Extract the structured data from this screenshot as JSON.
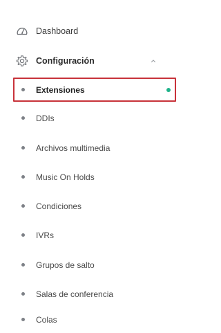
{
  "sidebar": {
    "dashboard": {
      "label": "Dashboard",
      "icon": "dashboard-gauge-icon"
    },
    "configuracion": {
      "label": "Configuración",
      "icon": "gear-icon",
      "expanded": true
    },
    "sub_items": [
      {
        "label": "Extensiones",
        "active": true
      },
      {
        "label": "DDIs"
      },
      {
        "label": "Archivos multimedia"
      },
      {
        "label": "Music On Holds"
      },
      {
        "label": "Condiciones"
      },
      {
        "label": "IVRs"
      },
      {
        "label": "Grupos de salto"
      },
      {
        "label": "Salas de conferencia"
      },
      {
        "label": "Colas"
      }
    ]
  },
  "colors": {
    "active_outline": "#c8323a",
    "active_indicator": "#1fb38a",
    "bullet": "#7d8086",
    "text": "#3b3b3b"
  }
}
